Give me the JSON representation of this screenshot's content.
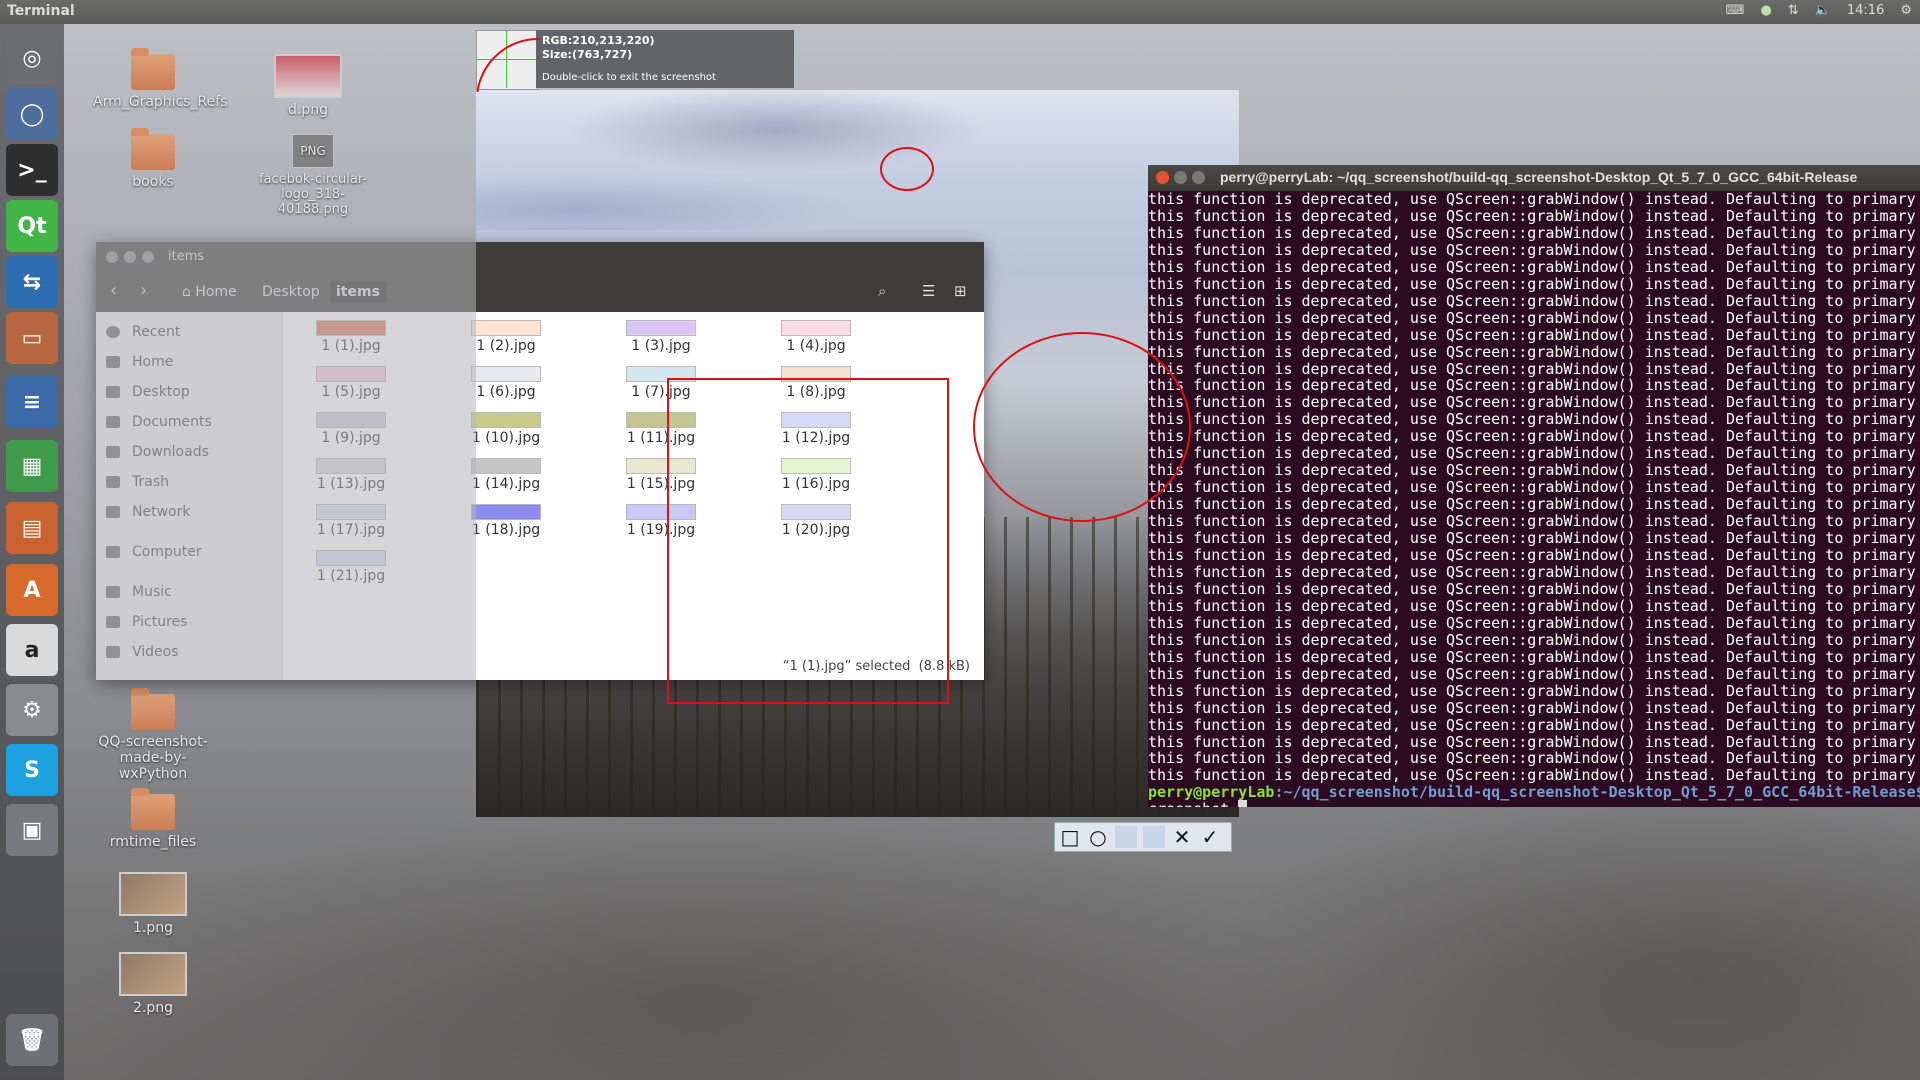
{
  "topbar": {
    "title": "Terminal",
    "clock": "14:16"
  },
  "desktop": {
    "icons": [
      {
        "label": "Arm_Graphics_Refs"
      },
      {
        "label": "d.png"
      },
      {
        "label": "books"
      },
      {
        "label": "facebok-circular-logo_318-40188.png",
        "thumb_text": "PNG"
      },
      {
        "label": "QQ-screenshot-made-by-wxPython"
      },
      {
        "label": "rmtime_files"
      },
      {
        "label": "1.png"
      },
      {
        "label": "2.png"
      }
    ]
  },
  "screenshot_info": {
    "rgb": "RGB:210,213,220)",
    "size": "Size:(763,727)",
    "hint": "Double-click to exit the screenshot"
  },
  "file_manager": {
    "title": "items",
    "breadcrumb": [
      "Home",
      "Desktop",
      "items"
    ],
    "sidebar": [
      "Recent",
      "Home",
      "Desktop",
      "Documents",
      "Downloads",
      "Trash",
      "Network",
      "Computer",
      "Music",
      "Pictures",
      "Videos"
    ],
    "files": [
      {
        "name": "1 (1).jpg",
        "color": "#e07b5a"
      },
      {
        "name": "1 (2).jpg",
        "color": "#fde4d4"
      },
      {
        "name": "1 (3).jpg",
        "color": "#dcc7f7"
      },
      {
        "name": "1 (4).jpg",
        "color": "#fcdbe7"
      },
      {
        "name": "1 (5).jpg",
        "color": "#f2ccd6"
      },
      {
        "name": "1 (6).jpg",
        "color": "#e8e8f0"
      },
      {
        "name": "1 (7).jpg",
        "color": "#d4e6ee"
      },
      {
        "name": "1 (8).jpg",
        "color": "#f4e0cf"
      },
      {
        "name": "1 (9).jpg",
        "color": "#c9c7d9"
      },
      {
        "name": "1 (10).jpg",
        "color": "#c9c98a"
      },
      {
        "name": "1 (11).jpg",
        "color": "#c6c492"
      },
      {
        "name": "1 (12).jpg",
        "color": "#d4d9f6"
      },
      {
        "name": "1 (13).jpg",
        "color": "#d4d4d4"
      },
      {
        "name": "1 (14).jpg",
        "color": "#c4c4c4"
      },
      {
        "name": "1 (15).jpg",
        "color": "#e9e7cf"
      },
      {
        "name": "1 (16).jpg",
        "color": "#e3f7cf"
      },
      {
        "name": "1 (17).jpg",
        "color": "#cfe4e6"
      },
      {
        "name": "1 (18).jpg",
        "color": "#8c8cf0"
      },
      {
        "name": "1 (19).jpg",
        "color": "#c6c9f6"
      },
      {
        "name": "1 (20).jpg",
        "color": "#d4d8f4"
      },
      {
        "name": "1 (21).jpg",
        "color": "#cfdcef"
      }
    ],
    "status": "“1 (1).jpg” selected  (8.8 kB)"
  },
  "terminal": {
    "title": "perry@perryLab: ~/qq_screenshot/build-qq_screenshot-Desktop_Qt_5_7_0_GCC_64bit-Release",
    "line": "this function is deprecated, use QScreen::grabWindow() instead. Defaulting to primary",
    "prompt_user": "perry@perryLab",
    "prompt_path": ":~/qq_screenshot/build-qq_screenshot-Desktop_Qt_5_7_0_GCC_64bit-Release$",
    "command": "creenshot "
  },
  "tools": [
    "rectangle-icon",
    "circle-icon",
    "blank-tool-icon",
    "blank-tool-icon",
    "close-icon",
    "check-icon"
  ]
}
